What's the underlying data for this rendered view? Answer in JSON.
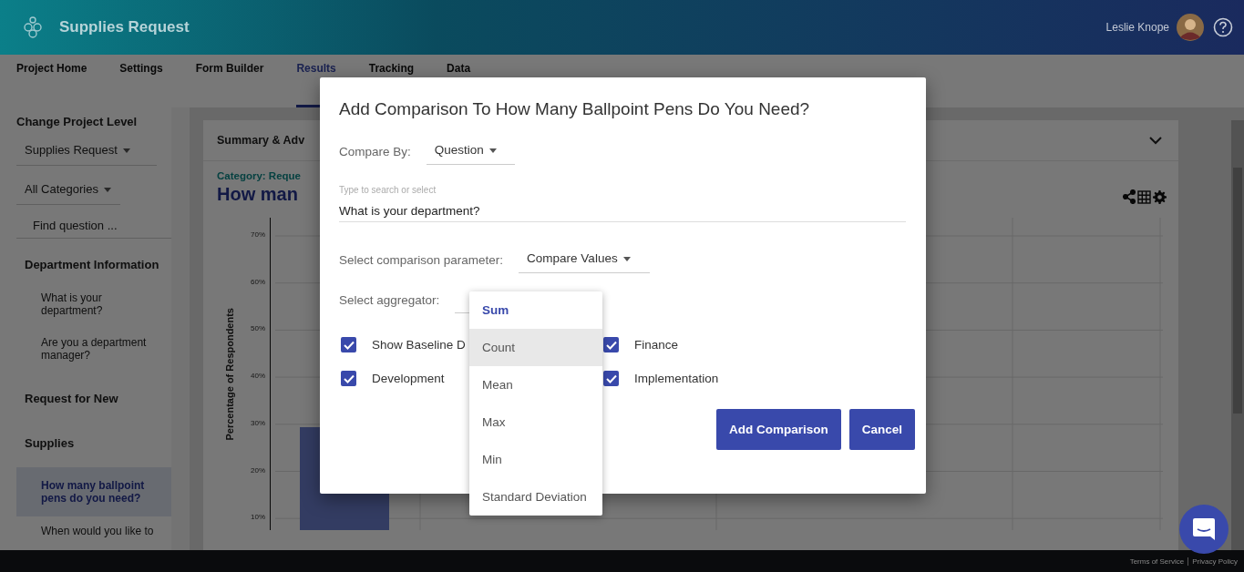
{
  "app": {
    "title": "Supplies Request",
    "user": "Leslie Knope"
  },
  "tabs": [
    {
      "label": "Project Home",
      "selected": false
    },
    {
      "label": "Settings",
      "selected": false
    },
    {
      "label": "Form Builder",
      "selected": false
    },
    {
      "label": "Results",
      "selected": true
    },
    {
      "label": "Tracking",
      "selected": false
    },
    {
      "label": "Data",
      "selected": false
    }
  ],
  "sidebar": {
    "heading": "Change Project Level",
    "project": "Supplies Request",
    "category": "All Categories",
    "search": {
      "placeholder": "Find question ..."
    },
    "items": [
      {
        "kind": "section",
        "label": "Department Information",
        "selected": false
      },
      {
        "kind": "question",
        "label": "What is your department?",
        "selected": false
      },
      {
        "kind": "question",
        "label": "Are you a department manager?",
        "selected": false
      },
      {
        "kind": "section",
        "label": "Request for New",
        "selected": false
      },
      {
        "kind": "section",
        "label": "Supplies",
        "selected": false
      },
      {
        "kind": "question",
        "label": "How many ballpoint pens do you need?",
        "selected": true
      },
      {
        "kind": "question",
        "label": "When would you like to",
        "selected": false
      }
    ]
  },
  "card": {
    "header": "Summary & Adv",
    "category": "Category: Reque",
    "question": "How man",
    "chart": {
      "ylabel": "Percentage of Respondents",
      "ticks": [
        "70%",
        "60%",
        "50%",
        "40%",
        "30%",
        "20%",
        "10%"
      ]
    }
  },
  "dialog": {
    "title": "Add Comparison To How Many Ballpoint Pens Do You Need?",
    "compare_by": {
      "label": "Compare By:",
      "value": "Question"
    },
    "question_field": {
      "label": "Type to search or select",
      "value": "What is your department?"
    },
    "parameter": {
      "label": "Select comparison parameter:",
      "value": "Compare Values"
    },
    "aggregator": {
      "label": "Select aggregator:"
    },
    "options": [
      {
        "label": "Show Baseline D",
        "checked": true
      },
      {
        "label": "Finance",
        "checked": true
      },
      {
        "label": "Development",
        "checked": true
      },
      {
        "label": "Implementation",
        "checked": true
      }
    ],
    "buttons": [
      "Add Comparison",
      "Cancel"
    ]
  },
  "menu": [
    {
      "label": "Sum",
      "selected": true,
      "highlighted": false
    },
    {
      "label": "Count",
      "selected": false,
      "highlighted": true
    },
    {
      "label": "Mean",
      "selected": false,
      "highlighted": false
    },
    {
      "label": "Max",
      "selected": false,
      "highlighted": false
    },
    {
      "label": "Min",
      "selected": false,
      "highlighted": false
    },
    {
      "label": "Standard Deviation",
      "selected": false,
      "highlighted": false
    }
  ],
  "footer": {
    "links": [
      "Terms of Service",
      "Privacy Policy"
    ]
  }
}
